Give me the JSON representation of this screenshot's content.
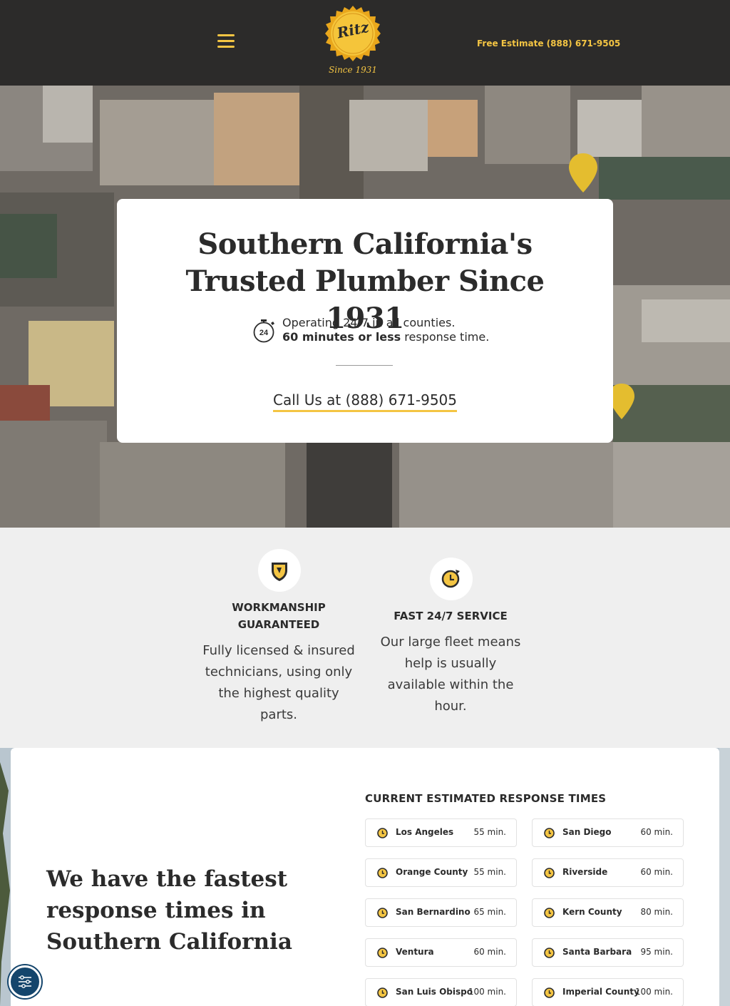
{
  "header": {
    "estimate_label": "Free Estimate (888) 671-9505",
    "logo_text": "Ritz",
    "logo_since": "Since 1931",
    "icons": {
      "menu": "hamburger-icon",
      "logo": "gold-seal-badge"
    },
    "colors": {
      "background": "#2c2b2a",
      "accent": "#f4c543"
    }
  },
  "hero": {
    "title": "Southern California's Trusted Plumber Since 1931",
    "hours_line1": "Operating 24/7 in all counties.",
    "hours_bold": "60 minutes or less",
    "hours_rest": " response time.",
    "timer_label": "24",
    "call_label": "Call Us at (888) 671-9505"
  },
  "features": [
    {
      "icon": "shield-icon",
      "title": "WORKMANSHIP GUARANTEED",
      "text": "Fully licensed & insured technicians, using only the highest quality parts."
    },
    {
      "icon": "fast-clock-icon",
      "title": "FAST 24/7 SERVICE",
      "text": "Our large fleet means help is usually available within the hour."
    }
  ],
  "response": {
    "heading": "We have the fastest response times in Southern California",
    "title": "CURRENT ESTIMATED RESPONSE TIMES",
    "counties": [
      {
        "name": "Los Angeles",
        "time": "55 min."
      },
      {
        "name": "San Diego",
        "time": "60 min."
      },
      {
        "name": "Orange County",
        "time": "55 min."
      },
      {
        "name": "Riverside",
        "time": "60 min."
      },
      {
        "name": "San Bernardino",
        "time": "65 min."
      },
      {
        "name": "Kern County",
        "time": "80 min."
      },
      {
        "name": "Ventura",
        "time": "60 min."
      },
      {
        "name": "Santa Barbara",
        "time": "95 min."
      },
      {
        "name": "San Luis Obispo",
        "time": "100 min."
      },
      {
        "name": "Imperial County",
        "time": "100 min."
      }
    ]
  },
  "accessibility": {
    "icon": "accessibility-sliders-icon",
    "color": "#14456c"
  }
}
